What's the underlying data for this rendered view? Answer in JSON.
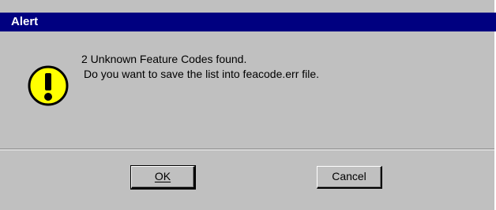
{
  "window": {
    "title": "Alert",
    "title_bar_color": "#000080",
    "face_color": "#c0c0c0"
  },
  "message": {
    "icon": "exclamation-icon",
    "icon_color": "#ffff00",
    "line1": "2 Unknown Feature Codes found.",
    "line2": "Do you want to save the list into feacode.err file."
  },
  "buttons": {
    "ok_label": "OK",
    "cancel_label": "Cancel"
  }
}
